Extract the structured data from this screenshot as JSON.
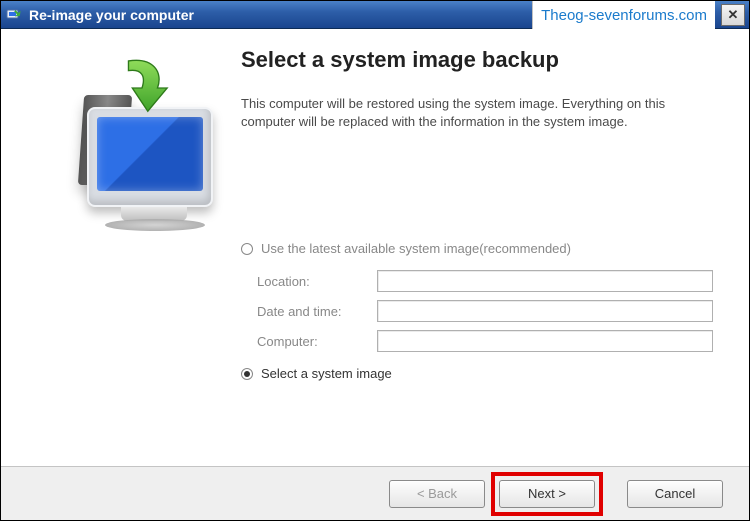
{
  "window": {
    "title": "Re-image your computer",
    "watermark": "Theog-sevenforums.com"
  },
  "page": {
    "heading": "Select a system image backup",
    "description": "This computer will be restored using the system image. Everything on this computer will be replaced with the information in the system image."
  },
  "options": {
    "use_latest_label": "Use the latest available system image(recommended)",
    "select_image_label": "Select a system image"
  },
  "fields": {
    "location_label": "Location:",
    "location_value": "",
    "datetime_label": "Date and time:",
    "datetime_value": "",
    "computer_label": "Computer:",
    "computer_value": ""
  },
  "buttons": {
    "back": "< Back",
    "next": "Next >",
    "cancel": "Cancel"
  }
}
